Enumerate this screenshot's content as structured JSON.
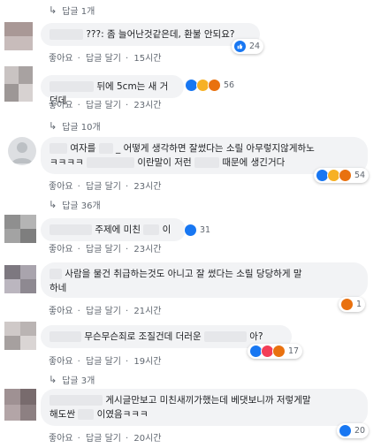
{
  "comments": [
    {
      "reply_link": "답글 1개",
      "name_hidden": "",
      "text": "???: 좀 늘어난것같은데, 환불 안되요?",
      "actions": {
        "like": "좋아요",
        "reply": "답글 달기",
        "time": "15시간"
      },
      "reactions": {
        "types": [
          "like"
        ],
        "count": "24"
      }
    },
    {
      "reply_link": "",
      "text": "뒤에 5cm는 새 거던데",
      "actions": {
        "like": "좋아요",
        "reply": "답글 달기",
        "time": "23시간"
      },
      "reactions": {
        "types": [
          "like",
          "haha",
          "angry"
        ],
        "count": "56"
      }
    },
    {
      "reply_link": "답글 10개",
      "text_a": "여자를",
      "text_b": "_",
      "text_c": "어떻게 생각하면 잘썼다는 소릴 아무렇지않게하노",
      "text_d": "ㅋㅋㅋㅋ",
      "text_e": "이란말이 저런",
      "text_f": "때문에 생긴거다",
      "actions": {
        "like": "좋아요",
        "reply": "답글 달기",
        "time": "23시간"
      },
      "reactions": {
        "types": [
          "like",
          "haha",
          "angry"
        ],
        "count": "54"
      }
    },
    {
      "reply_link": "답글 36개",
      "text_a": "주제에 미친",
      "text_b": "이",
      "actions": {
        "like": "좋아요",
        "reply": "답글 달기",
        "time": "23시간"
      },
      "reactions": {
        "types": [
          "like"
        ],
        "count": "31"
      }
    },
    {
      "reply_link": "",
      "text_a": "사람을 물건 취급하는것도 아니고 잘 썼다는 소릴 당당하게 말",
      "text_b": "하네",
      "actions": {
        "like": "좋아요",
        "reply": "답글 달기",
        "time": "21시간"
      },
      "reactions": {
        "types": [
          "angry"
        ],
        "count": "1"
      }
    },
    {
      "reply_link": "",
      "text_a": "무슨무슨죄로 조질건데 더러운",
      "text_b": "아?",
      "actions": {
        "like": "좋아요",
        "reply": "답글 달기",
        "time": "19시간"
      },
      "reactions": {
        "types": [
          "like",
          "love",
          "angry"
        ],
        "count": "17"
      }
    },
    {
      "reply_link": "답글 3개",
      "text_a": "게시글만보고 미친새끼가했는데 베댓보니까 저렇게말",
      "text_b": "해도싼",
      "text_c": "이였음ㅋㅋㅋ",
      "actions": {
        "like": "좋아요",
        "reply": "답글 달기",
        "time": "20시간"
      },
      "reactions": {
        "types": [
          "like"
        ],
        "count": "20"
      }
    }
  ],
  "icons": {
    "reply_arrow": "reply-arrow-icon",
    "like": "like-icon",
    "haha": "haha-icon",
    "angry": "angry-icon",
    "love": "love-icon"
  },
  "colors": {
    "like": "#1877f2",
    "haha": "#f7b125",
    "angry": "#e9710f",
    "love": "#f33e58",
    "bubble": "#f2f3f5",
    "meta": "#606770"
  }
}
